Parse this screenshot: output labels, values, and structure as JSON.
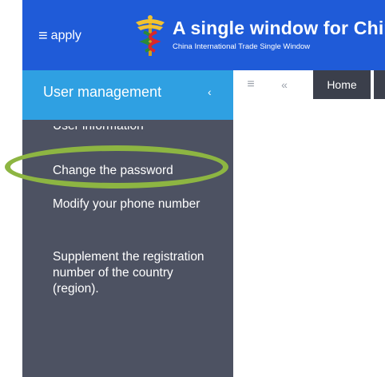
{
  "header": {
    "menu_label": "apply",
    "title": "A single window for China",
    "subtitle": "China International Trade Single Window",
    "hamburger_icon": "≡",
    "brand_color": "#1f5bd8"
  },
  "sidebar": {
    "header_label": "User management",
    "collapse_icon": "‹",
    "items": [
      {
        "label": "User information"
      },
      {
        "label": "Change the password"
      },
      {
        "label": "Modify your phone number"
      },
      {
        "label": "Supplement the registration number of the country (region)."
      }
    ],
    "highlight_color": "#8db542"
  },
  "tabbar": {
    "menu_icon": "≡",
    "prev_icon": "«",
    "home_label": "Home"
  }
}
